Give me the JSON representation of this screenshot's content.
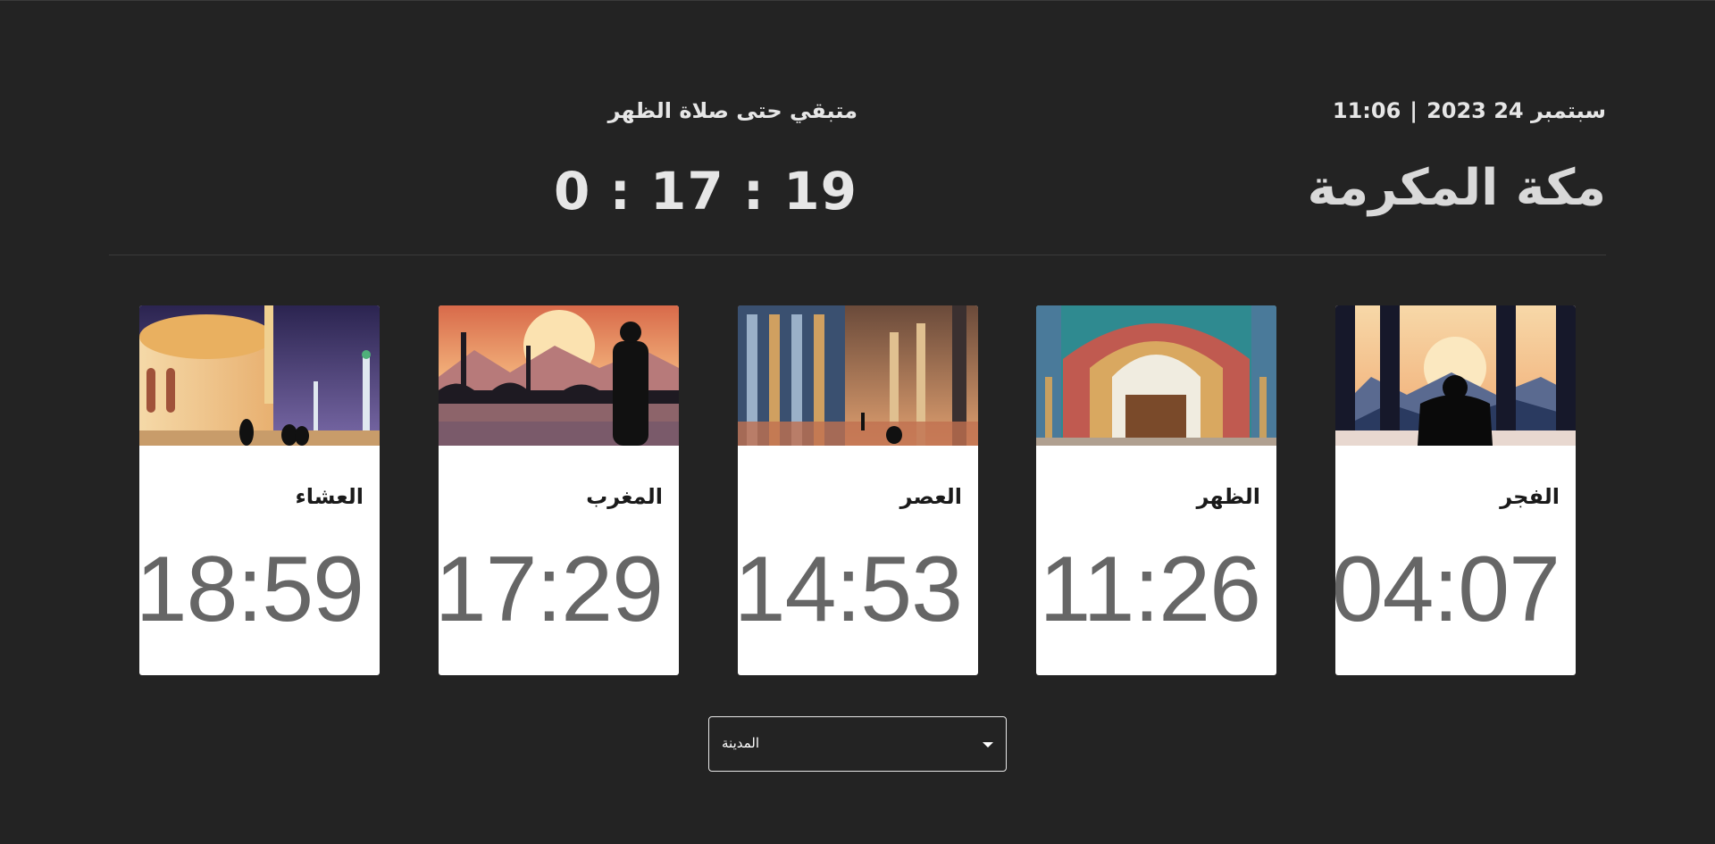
{
  "header": {
    "date": "سبتمبر 24 2023",
    "separator": "|",
    "time": "11:06",
    "city": "مكة المكرمة",
    "remaining_label": "متبقي حتى صلاة الظهر",
    "countdown": "0 : 17 : 19"
  },
  "prayers": [
    {
      "name": "الفجر",
      "time": "04:07",
      "image": "fajr-illustration"
    },
    {
      "name": "الظهر",
      "time": "11:26",
      "image": "dhuhr-illustration"
    },
    {
      "name": "العصر",
      "time": "14:53",
      "image": "asr-illustration"
    },
    {
      "name": "المغرب",
      "time": "17:29",
      "image": "maghrib-illustration"
    },
    {
      "name": "العشاء",
      "time": "18:59",
      "image": "isha-illustration"
    }
  ],
  "city_select": {
    "label": "المدينة",
    "icon": "chevron-down-icon"
  },
  "colors": {
    "background": "#232323",
    "card": "#ffffff",
    "time_text": "#666666",
    "header_text": "#e6e6e6"
  }
}
